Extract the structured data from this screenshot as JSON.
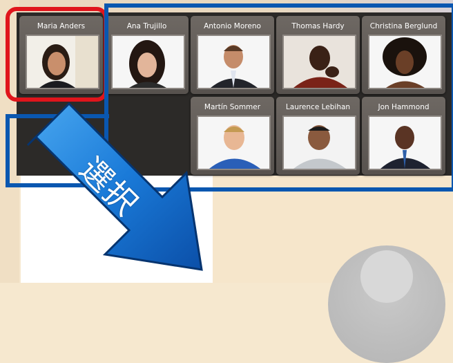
{
  "contacts": [
    {
      "name": "Maria Anders"
    },
    {
      "name": "Ana Trujillo"
    },
    {
      "name": "Antonio Moreno"
    },
    {
      "name": "Thomas Hardy"
    },
    {
      "name": "Christina Berglund"
    },
    {
      "name": "Martín Sommer"
    },
    {
      "name": "Laurence Lebihan"
    },
    {
      "name": "Jon Hammond"
    }
  ],
  "annotation": {
    "arrow_label": "選択"
  },
  "colors": {
    "selection_red": "#e0151c",
    "selection_blue": "#0a57b0",
    "arrow_blue": "#1a7ad8",
    "card_bg": "#5f5a56"
  }
}
